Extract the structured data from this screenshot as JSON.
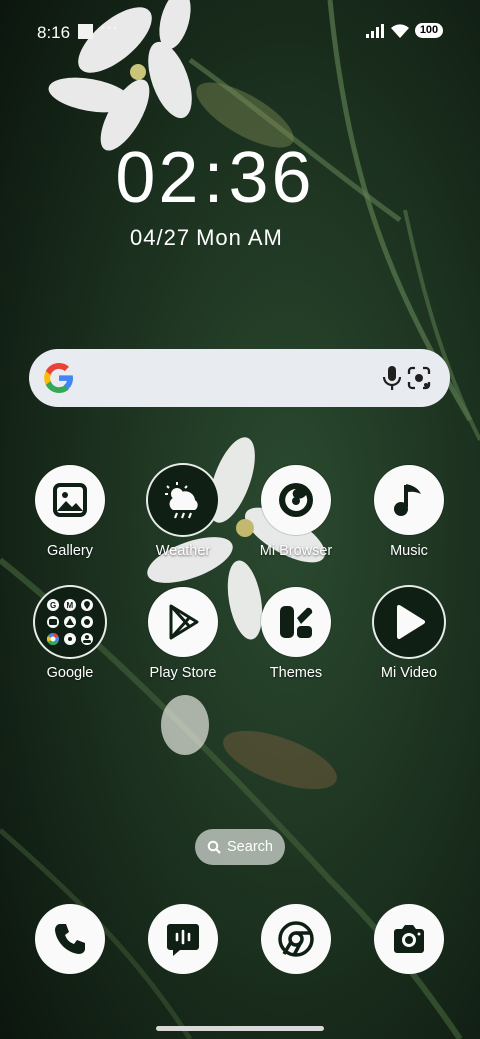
{
  "status_bar": {
    "time": "8:16",
    "more": "···",
    "battery": "100"
  },
  "lockscreen_clock": {
    "hours": "02",
    "minutes": "36",
    "date": "04/27",
    "weekday": "Mon",
    "ampm": "AM"
  },
  "search_widget": {
    "icons": [
      "google-g-icon",
      "microphone-icon",
      "google-lens-icon"
    ]
  },
  "apps": [
    {
      "label": "Gallery",
      "icon": "gallery-icon"
    },
    {
      "label": "Weather",
      "icon": "weather-icon"
    },
    {
      "label": "Mi Browser",
      "icon": "mi-browser-icon"
    },
    {
      "label": "Music",
      "icon": "music-note-icon"
    },
    {
      "label": "Google",
      "icon": "google-folder-icon"
    },
    {
      "label": "Play Store",
      "icon": "play-store-icon"
    },
    {
      "label": "Themes",
      "icon": "themes-icon"
    },
    {
      "label": "Mi Video",
      "icon": "play-icon"
    }
  ],
  "app_search": {
    "label": "Search",
    "icon": "search-icon"
  },
  "dock": [
    {
      "icon": "phone-icon"
    },
    {
      "icon": "messages-icon"
    },
    {
      "icon": "chrome-icon"
    },
    {
      "icon": "camera-icon"
    }
  ],
  "colors": {
    "icon_background": "#fafafa",
    "icon_glyph": "#0f1f14",
    "search_bar": "#e8ebef"
  }
}
